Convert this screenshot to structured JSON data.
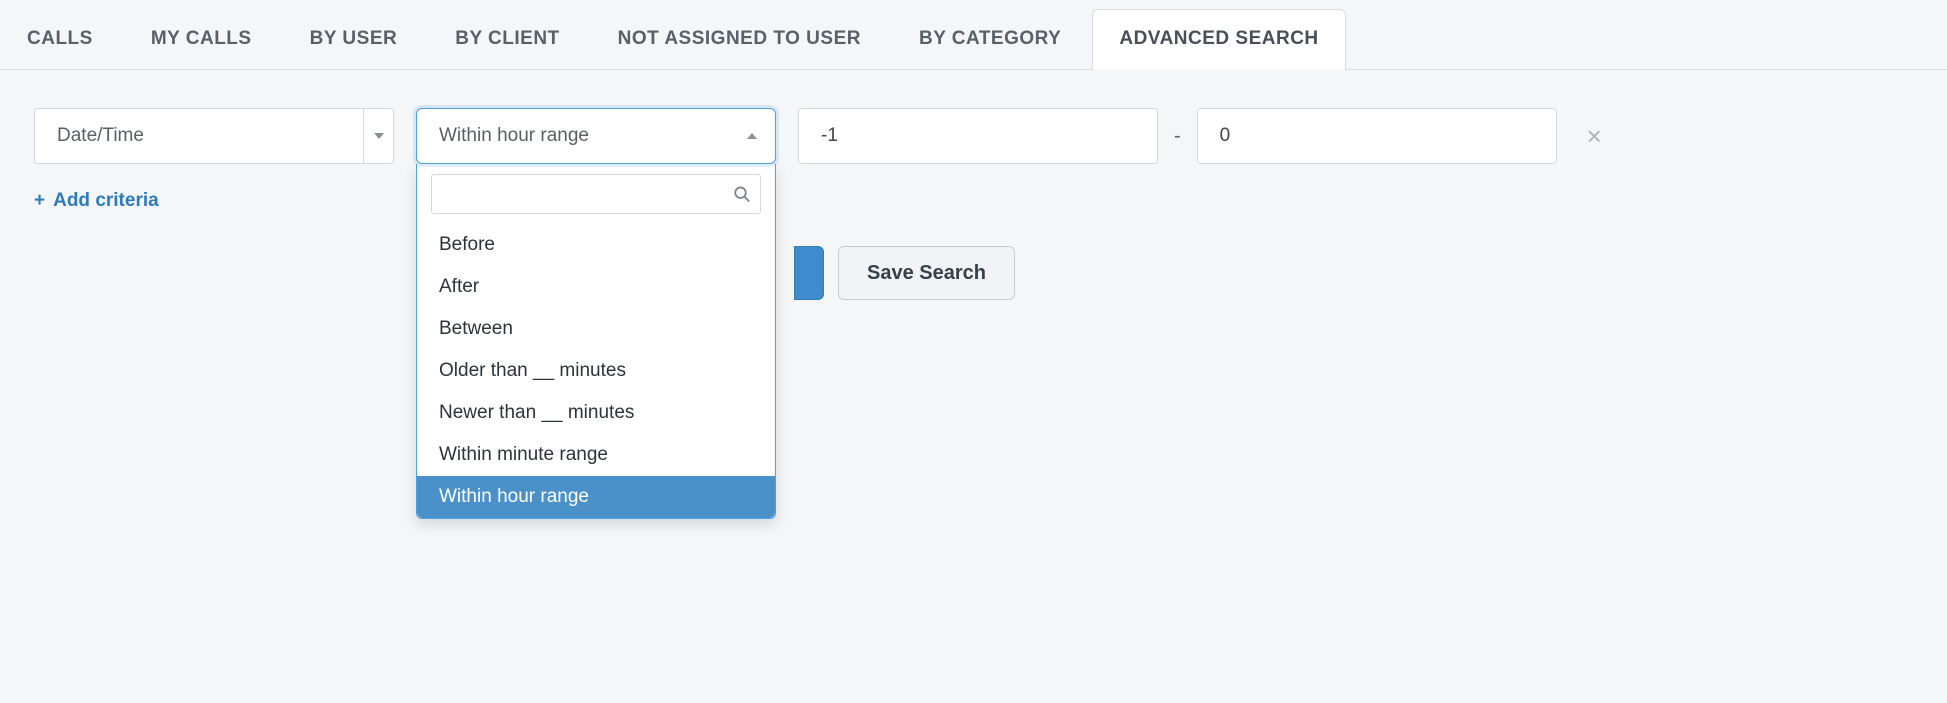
{
  "tabs": [
    {
      "label": "CALLS",
      "active": false
    },
    {
      "label": "MY CALLS",
      "active": false
    },
    {
      "label": "BY USER",
      "active": false
    },
    {
      "label": "BY CLIENT",
      "active": false
    },
    {
      "label": "NOT ASSIGNED TO USER",
      "active": false
    },
    {
      "label": "BY CATEGORY",
      "active": false
    },
    {
      "label": "ADVANCED SEARCH",
      "active": true
    }
  ],
  "criteria": {
    "field_selected": "Date/Time",
    "operator_selected": "Within hour range",
    "value_from": "-1",
    "value_to": "0",
    "range_separator": "-"
  },
  "operator_dropdown": {
    "search_value": "",
    "options": [
      {
        "label": "Before",
        "selected": false
      },
      {
        "label": "After",
        "selected": false
      },
      {
        "label": "Between",
        "selected": false
      },
      {
        "label": "Older than __ minutes",
        "selected": false
      },
      {
        "label": "Newer than __ minutes",
        "selected": false
      },
      {
        "label": "Within minute range",
        "selected": false
      },
      {
        "label": "Within hour range",
        "selected": true
      }
    ]
  },
  "add_criteria_label": "Add criteria",
  "buttons": {
    "save_search": "Save Search"
  }
}
